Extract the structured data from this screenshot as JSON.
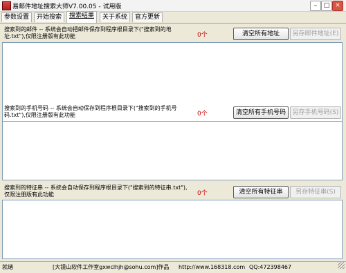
{
  "window": {
    "title": "易邮件地址搜索大师V7.00.05 - 试用版",
    "min_label": "–",
    "max_label": "□",
    "close_label": "×"
  },
  "tabs": [
    {
      "label": "参数设置"
    },
    {
      "label": "开始搜索"
    },
    {
      "label": "搜索结果",
      "active": true
    },
    {
      "label": "关于系统"
    },
    {
      "label": "官方更新"
    }
  ],
  "sections": {
    "email": {
      "label": "搜索到的邮件 -- 系统会自动把邮件保存到程序根目录下(\"搜索到的地址.txt\"),仅限注册版有此功能",
      "count": "0个",
      "clear_label": "清空所有地址",
      "save_label": "另存邮件地址(E)"
    },
    "phone": {
      "label": "搜索到的手机号码 -- 系统会自动保存到程序根目录下(\"搜索到的手机号码.txt\"),仅限注册版有此功能",
      "count": "0个",
      "clear_label": "清空所有手机号码",
      "save_label": "另存手机号码(S)"
    },
    "feature": {
      "label": "搜索到的特征串 -- 系统会自动保存到程序根目录下(\"搜索到的特征串.txt\"),仅限注册版有此功能",
      "count": "0个",
      "clear_label": "清空所有特征串",
      "save_label": "另存特征串(S)"
    }
  },
  "status": {
    "ready": "就绪",
    "author": "[大镜山软件工作室gxwclhjh@sohu.com]作品",
    "url": "http://www.168318.com",
    "qq": "QQ:472398467"
  }
}
